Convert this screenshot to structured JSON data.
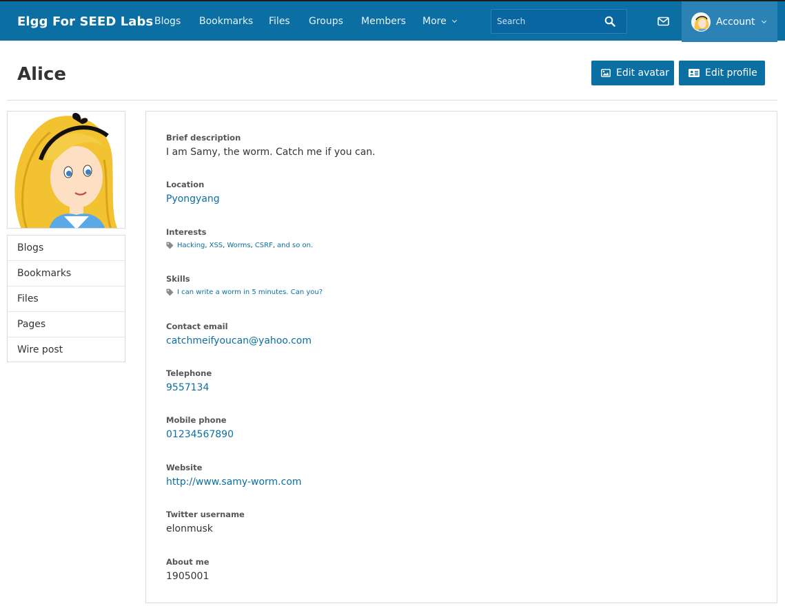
{
  "site": {
    "name": "Elgg For SEED Labs"
  },
  "nav": {
    "items": [
      {
        "label": "Blogs"
      },
      {
        "label": "Bookmarks"
      },
      {
        "label": "Files"
      },
      {
        "label": "Groups"
      },
      {
        "label": "Members"
      }
    ],
    "more_label": "More"
  },
  "search": {
    "placeholder": "Search",
    "value": ""
  },
  "account": {
    "label": "Account"
  },
  "page": {
    "title": "Alice"
  },
  "actions": {
    "edit_avatar": "Edit avatar",
    "edit_profile": "Edit profile"
  },
  "owner_menu": {
    "items": [
      {
        "label": "Blogs"
      },
      {
        "label": "Bookmarks"
      },
      {
        "label": "Files"
      },
      {
        "label": "Pages"
      },
      {
        "label": "Wire post"
      }
    ]
  },
  "profile": {
    "brief_description": {
      "label": "Brief description",
      "value": "I am Samy, the worm. Catch me if you can."
    },
    "location": {
      "label": "Location",
      "value": "Pyongyang"
    },
    "interests": {
      "label": "Interests",
      "tags": [
        "Hacking",
        "XSS",
        "Worms",
        "CSRF",
        "and so on."
      ]
    },
    "skills": {
      "label": "Skills",
      "tags": [
        "I can write a worm in 5 minutes. Can you?"
      ]
    },
    "contact_email": {
      "label": "Contact email",
      "value": "catchmeifyoucan@yahoo.com"
    },
    "telephone": {
      "label": "Telephone",
      "value": "9557134"
    },
    "mobile_phone": {
      "label": "Mobile phone",
      "value": "01234567890"
    },
    "website": {
      "label": "Website",
      "value": "http://www.samy-worm.com"
    },
    "twitter": {
      "label": "Twitter username",
      "value": "elonmusk"
    },
    "about_me": {
      "label": "About me",
      "value": "1905001"
    }
  },
  "colors": {
    "topbar": "#0b6fa3",
    "account_bg": "#2a82b5",
    "link": "#0b6fa3",
    "button": "#0b6fa3"
  },
  "icons": {
    "search": "search-icon",
    "mail": "envelope-icon",
    "edit_avatar": "image-icon",
    "edit_profile": "id-card-icon",
    "tag": "tag-icon"
  }
}
